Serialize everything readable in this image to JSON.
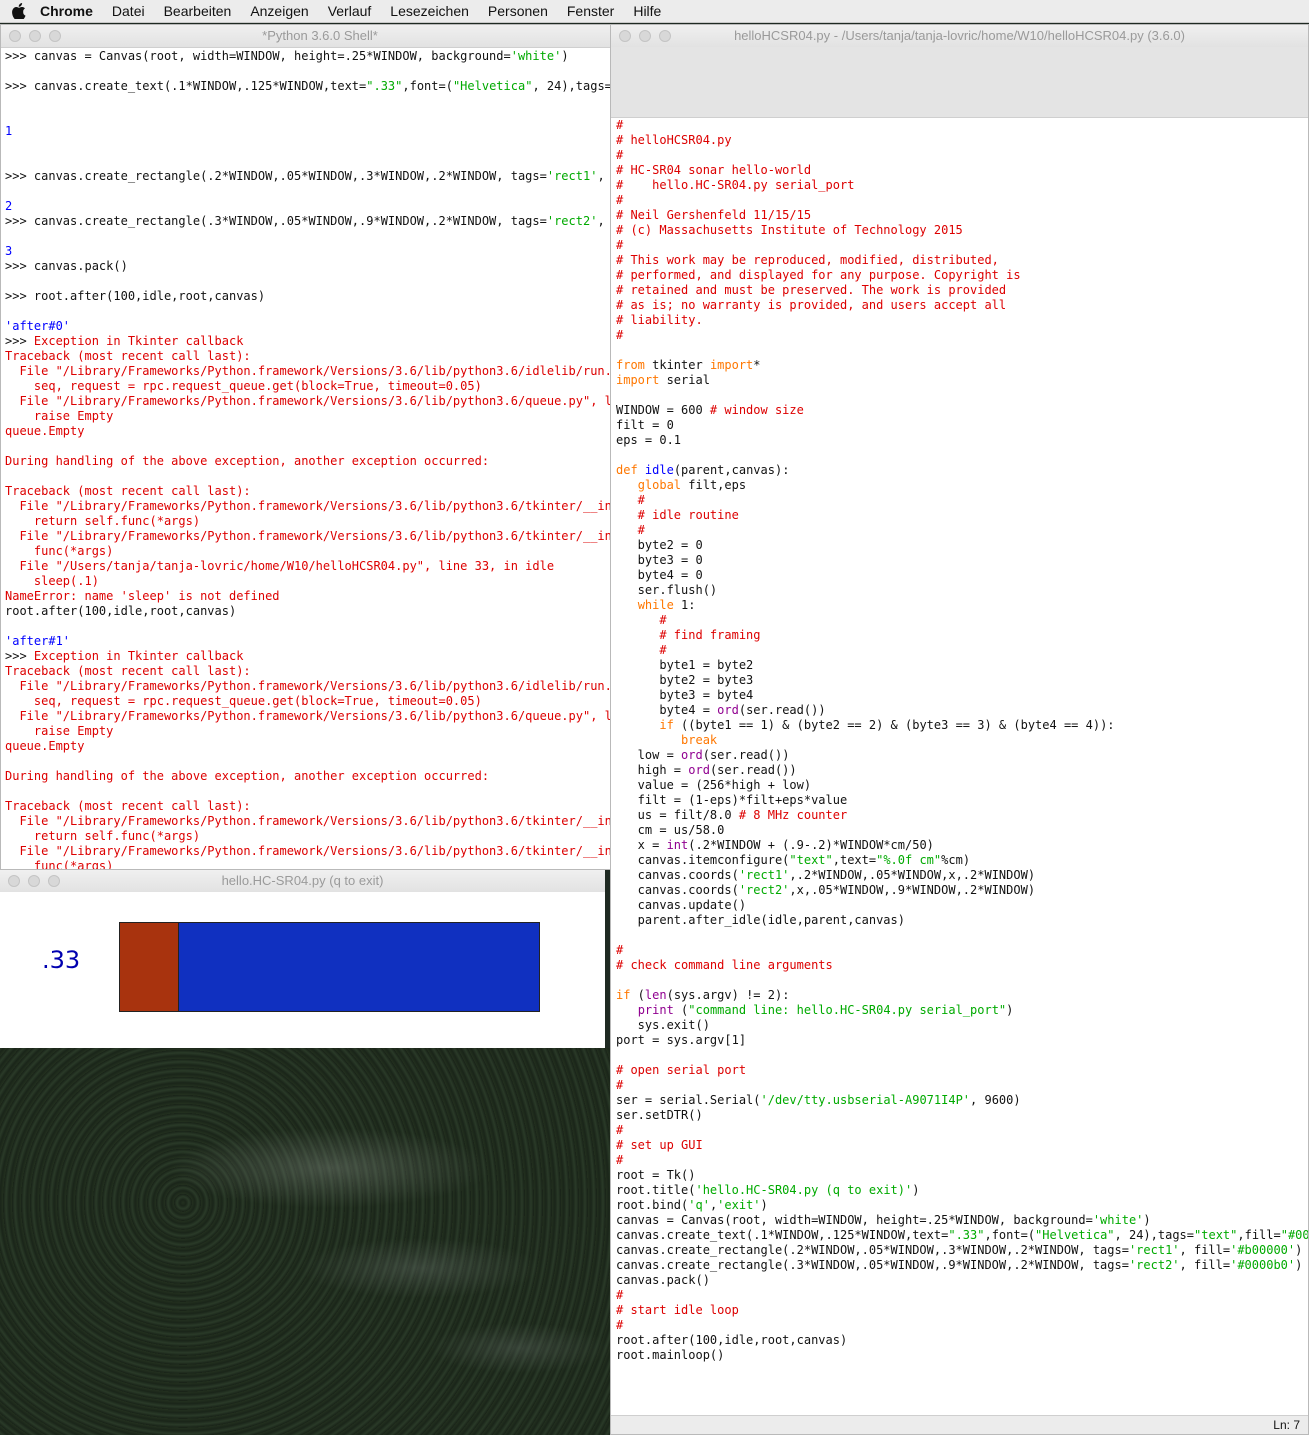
{
  "menubar": {
    "app": "Chrome",
    "items": [
      "Datei",
      "Bearbeiten",
      "Anzeigen",
      "Verlauf",
      "Lesezeichen",
      "Personen",
      "Fenster",
      "Hilfe"
    ]
  },
  "shell": {
    "title": "*Python 3.6.0 Shell*",
    "lines": [
      [
        [
          ">>> ",
          "sh"
        ],
        [
          "canvas = Canvas(root, width=WINDOW, height=.25*WINDOW, background=",
          "sh"
        ],
        [
          "'white'",
          "s"
        ],
        [
          ")",
          "sh"
        ]
      ],
      [
        [
          "",
          "sh"
        ]
      ],
      [
        [
          ">>> ",
          "sh"
        ],
        [
          "canvas.create_text(.1*WINDOW,.125*WINDOW,text=",
          "sh"
        ],
        [
          "\".33\"",
          "s"
        ],
        [
          ",font=(",
          "sh"
        ],
        [
          "\"Helvetica\"",
          "s"
        ],
        [
          ", 24),tags=",
          "sh"
        ],
        [
          "\"te",
          "s"
        ]
      ],
      [
        [
          "",
          "sh"
        ]
      ],
      [
        [
          "",
          "sh"
        ]
      ],
      [
        [
          "1",
          "o"
        ]
      ],
      [
        [
          "",
          "sh"
        ]
      ],
      [
        [
          "",
          "sh"
        ]
      ],
      [
        [
          ">>> ",
          "sh"
        ],
        [
          "canvas.create_rectangle(.2*WINDOW,.05*WINDOW,.3*WINDOW,.2*WINDOW, tags=",
          "sh"
        ],
        [
          "'rect1'",
          "s"
        ],
        [
          ", fil",
          "sh"
        ]
      ],
      [
        [
          "",
          "sh"
        ]
      ],
      [
        [
          "2",
          "o"
        ]
      ],
      [
        [
          ">>> ",
          "sh"
        ],
        [
          "canvas.create_rectangle(.3*WINDOW,.05*WINDOW,.9*WINDOW,.2*WINDOW, tags=",
          "sh"
        ],
        [
          "'rect2'",
          "s"
        ],
        [
          ", fil",
          "sh"
        ]
      ],
      [
        [
          "",
          "sh"
        ]
      ],
      [
        [
          "3",
          "o"
        ]
      ],
      [
        [
          ">>> ",
          "sh"
        ],
        [
          "canvas.pack()",
          "sh"
        ]
      ],
      [
        [
          "",
          "sh"
        ]
      ],
      [
        [
          ">>> ",
          "sh"
        ],
        [
          "root.after(100,idle,root,canvas)",
          "sh"
        ]
      ],
      [
        [
          "",
          "sh"
        ]
      ],
      [
        [
          "'after#0'",
          "o"
        ]
      ],
      [
        [
          ">>> ",
          "sh"
        ],
        [
          "Exception in Tkinter callback",
          "e"
        ]
      ],
      [
        [
          "Traceback (most recent call last):",
          "e"
        ]
      ],
      [
        [
          "  File \"/Library/Frameworks/Python.framework/Versions/3.6/lib/python3.6/idlelib/run.py\"",
          "e"
        ]
      ],
      [
        [
          "    seq, request = rpc.request_queue.get(block=True, timeout=0.05)",
          "e"
        ]
      ],
      [
        [
          "  File \"/Library/Frameworks/Python.framework/Versions/3.6/lib/python3.6/queue.py\", line",
          "e"
        ]
      ],
      [
        [
          "    raise Empty",
          "e"
        ]
      ],
      [
        [
          "queue.Empty",
          "e"
        ]
      ],
      [
        [
          "",
          "sh"
        ]
      ],
      [
        [
          "During handling of the above exception, another exception occurred:",
          "e"
        ]
      ],
      [
        [
          "",
          "sh"
        ]
      ],
      [
        [
          "Traceback (most recent call last):",
          "e"
        ]
      ],
      [
        [
          "  File \"/Library/Frameworks/Python.framework/Versions/3.6/lib/python3.6/tkinter/__init_",
          "e"
        ]
      ],
      [
        [
          "    return self.func(*args)",
          "e"
        ]
      ],
      [
        [
          "  File \"/Library/Frameworks/Python.framework/Versions/3.6/lib/python3.6/tkinter/__init_",
          "e"
        ]
      ],
      [
        [
          "    func(*args)",
          "e"
        ]
      ],
      [
        [
          "  File \"/Users/tanja/tanja-lovric/home/W10/helloHCSR04.py\", line 33, in idle",
          "e"
        ]
      ],
      [
        [
          "    sleep(.1)",
          "e"
        ]
      ],
      [
        [
          "NameError: name 'sleep' is not defined",
          "e"
        ]
      ],
      [
        [
          "root.after(100,idle,root,canvas)",
          "sh"
        ]
      ],
      [
        [
          "",
          "sh"
        ]
      ],
      [
        [
          "'after#1'",
          "o"
        ]
      ],
      [
        [
          ">>> ",
          "sh"
        ],
        [
          "Exception in Tkinter callback",
          "e"
        ]
      ],
      [
        [
          "Traceback (most recent call last):",
          "e"
        ]
      ],
      [
        [
          "  File \"/Library/Frameworks/Python.framework/Versions/3.6/lib/python3.6/idlelib/run.py\"",
          "e"
        ]
      ],
      [
        [
          "    seq, request = rpc.request_queue.get(block=True, timeout=0.05)",
          "e"
        ]
      ],
      [
        [
          "  File \"/Library/Frameworks/Python.framework/Versions/3.6/lib/python3.6/queue.py\", line",
          "e"
        ]
      ],
      [
        [
          "    raise Empty",
          "e"
        ]
      ],
      [
        [
          "queue.Empty",
          "e"
        ]
      ],
      [
        [
          "",
          "sh"
        ]
      ],
      [
        [
          "During handling of the above exception, another exception occurred:",
          "e"
        ]
      ],
      [
        [
          "",
          "sh"
        ]
      ],
      [
        [
          "Traceback (most recent call last):",
          "e"
        ]
      ],
      [
        [
          "  File \"/Library/Frameworks/Python.framework/Versions/3.6/lib/python3.6/tkinter/__init_",
          "e"
        ]
      ],
      [
        [
          "    return self.func(*args)",
          "e"
        ]
      ],
      [
        [
          "  File \"/Library/Frameworks/Python.framework/Versions/3.6/lib/python3.6/tkinter/__init_",
          "e"
        ]
      ],
      [
        [
          "    func(*args)",
          "e"
        ]
      ]
    ]
  },
  "hello": {
    "title": "hello.HC-SR04.py (q to exit)",
    "text": ".33",
    "text_color": "#0000b0",
    "rect1_color": "#a8330e",
    "rect2_color": "#1030c0",
    "fraction_rect1": 0.33
  },
  "editor": {
    "title": "helloHCSR04.py - /Users/tanja/tanja-lovric/home/W10/helloHCSR04.py (3.6.0)",
    "status": "Ln: 7",
    "lines": [
      [
        [
          "#",
          "c"
        ]
      ],
      [
        [
          "# helloHCSR04.py",
          "c"
        ]
      ],
      [
        [
          "#",
          "c"
        ]
      ],
      [
        [
          "# HC-SR04 sonar hello-world",
          "c"
        ]
      ],
      [
        [
          "#    hello.HC-SR04.py serial_port",
          "c"
        ]
      ],
      [
        [
          "#",
          "c"
        ]
      ],
      [
        [
          "# Neil Gershenfeld 11/15/15",
          "c"
        ]
      ],
      [
        [
          "# (c) Massachusetts Institute of Technology 2015",
          "c"
        ]
      ],
      [
        [
          "#",
          "c"
        ]
      ],
      [
        [
          "# This work may be reproduced, modified, distributed,",
          "c"
        ]
      ],
      [
        [
          "# performed, and displayed for any purpose. Copyright is",
          "c"
        ]
      ],
      [
        [
          "# retained and must be preserved. The work is provided",
          "c"
        ]
      ],
      [
        [
          "# as is; no warranty is provided, and users accept all",
          "c"
        ]
      ],
      [
        [
          "# liability.",
          "c"
        ]
      ],
      [
        [
          "#",
          "c"
        ]
      ],
      [
        [
          "",
          "sh"
        ]
      ],
      [
        [
          "from",
          "k"
        ],
        [
          " tkinter ",
          "sh"
        ],
        [
          "import",
          "k"
        ],
        [
          "*",
          "sh"
        ]
      ],
      [
        [
          "import",
          "k"
        ],
        [
          " serial",
          "sh"
        ]
      ],
      [
        [
          "",
          "sh"
        ]
      ],
      [
        [
          "WINDOW = 600 ",
          "sh"
        ],
        [
          "# window size",
          "c"
        ]
      ],
      [
        [
          "filt = 0",
          "sh"
        ]
      ],
      [
        [
          "eps = 0.1",
          "sh"
        ]
      ],
      [
        [
          "",
          "sh"
        ]
      ],
      [
        [
          "def",
          "k"
        ],
        [
          " ",
          "sh"
        ],
        [
          "idle",
          "d"
        ],
        [
          "(parent,canvas):",
          "sh"
        ]
      ],
      [
        [
          "   ",
          "sh"
        ],
        [
          "global",
          "k"
        ],
        [
          " filt,eps",
          "sh"
        ]
      ],
      [
        [
          "   #",
          "c"
        ]
      ],
      [
        [
          "   # idle routine",
          "c"
        ]
      ],
      [
        [
          "   #",
          "c"
        ]
      ],
      [
        [
          "   byte2 = 0",
          "sh"
        ]
      ],
      [
        [
          "   byte3 = 0",
          "sh"
        ]
      ],
      [
        [
          "   byte4 = 0",
          "sh"
        ]
      ],
      [
        [
          "   ser.flush()",
          "sh"
        ]
      ],
      [
        [
          "   ",
          "sh"
        ],
        [
          "while",
          "k"
        ],
        [
          " 1:",
          "sh"
        ]
      ],
      [
        [
          "      #",
          "c"
        ]
      ],
      [
        [
          "      # find framing",
          "c"
        ]
      ],
      [
        [
          "      #",
          "c"
        ]
      ],
      [
        [
          "      byte1 = byte2",
          "sh"
        ]
      ],
      [
        [
          "      byte2 = byte3",
          "sh"
        ]
      ],
      [
        [
          "      byte3 = byte4",
          "sh"
        ]
      ],
      [
        [
          "      byte4 = ",
          "sh"
        ],
        [
          "ord",
          "b"
        ],
        [
          "(ser.read())",
          "sh"
        ]
      ],
      [
        [
          "      ",
          "sh"
        ],
        [
          "if",
          "k"
        ],
        [
          " ((byte1 == 1) & (byte2 == 2) & (byte3 == 3) & (byte4 == 4)):",
          "sh"
        ]
      ],
      [
        [
          "         ",
          "sh"
        ],
        [
          "break",
          "k"
        ]
      ],
      [
        [
          "   low = ",
          "sh"
        ],
        [
          "ord",
          "b"
        ],
        [
          "(ser.read())",
          "sh"
        ]
      ],
      [
        [
          "   high = ",
          "sh"
        ],
        [
          "ord",
          "b"
        ],
        [
          "(ser.read())",
          "sh"
        ]
      ],
      [
        [
          "   value = (256*high + low)",
          "sh"
        ]
      ],
      [
        [
          "   filt = (1-eps)*filt+eps*value",
          "sh"
        ]
      ],
      [
        [
          "   us = filt/8.0 ",
          "sh"
        ],
        [
          "# 8 MHz counter",
          "c"
        ]
      ],
      [
        [
          "   cm = us/58.0",
          "sh"
        ]
      ],
      [
        [
          "   x = ",
          "sh"
        ],
        [
          "int",
          "b"
        ],
        [
          "(.2*WINDOW + (.9-.2)*WINDOW*cm/50)",
          "sh"
        ]
      ],
      [
        [
          "   canvas.itemconfigure(",
          "sh"
        ],
        [
          "\"text\"",
          "s"
        ],
        [
          ",text=",
          "sh"
        ],
        [
          "\"%.0f cm\"",
          "s"
        ],
        [
          "%cm)",
          "sh"
        ]
      ],
      [
        [
          "   canvas.coords(",
          "sh"
        ],
        [
          "'rect1'",
          "s"
        ],
        [
          ",.2*WINDOW,.05*WINDOW,x,.2*WINDOW)",
          "sh"
        ]
      ],
      [
        [
          "   canvas.coords(",
          "sh"
        ],
        [
          "'rect2'",
          "s"
        ],
        [
          ",x,.05*WINDOW,.9*WINDOW,.2*WINDOW)",
          "sh"
        ]
      ],
      [
        [
          "   canvas.update()",
          "sh"
        ]
      ],
      [
        [
          "   parent.after_idle(idle,parent,canvas)",
          "sh"
        ]
      ],
      [
        [
          "",
          "sh"
        ]
      ],
      [
        [
          "#",
          "c"
        ]
      ],
      [
        [
          "# check command line arguments",
          "c"
        ]
      ],
      [
        [
          "",
          "sh"
        ]
      ],
      [
        [
          "if",
          "k"
        ],
        [
          " (",
          "sh"
        ],
        [
          "len",
          "b"
        ],
        [
          "(sys.argv) != 2):",
          "sh"
        ]
      ],
      [
        [
          "   ",
          "sh"
        ],
        [
          "print",
          "b"
        ],
        [
          " (",
          "sh"
        ],
        [
          "\"command line: hello.HC-SR04.py serial_port\"",
          "s"
        ],
        [
          ")",
          "sh"
        ]
      ],
      [
        [
          "   sys.exit()",
          "sh"
        ]
      ],
      [
        [
          "port = sys.argv[1]",
          "sh"
        ]
      ],
      [
        [
          "",
          "sh"
        ]
      ],
      [
        [
          "# open serial port",
          "c"
        ]
      ],
      [
        [
          "#",
          "c"
        ]
      ],
      [
        [
          "ser = serial.Serial(",
          "sh"
        ],
        [
          "'/dev/tty.usbserial-A9071I4P'",
          "s"
        ],
        [
          ", 9600)",
          "sh"
        ]
      ],
      [
        [
          "ser.setDTR()",
          "sh"
        ]
      ],
      [
        [
          "#",
          "c"
        ]
      ],
      [
        [
          "# set up GUI",
          "c"
        ]
      ],
      [
        [
          "#",
          "c"
        ]
      ],
      [
        [
          "root = Tk()",
          "sh"
        ]
      ],
      [
        [
          "root.title(",
          "sh"
        ],
        [
          "'hello.HC-SR04.py (q to exit)'",
          "s"
        ],
        [
          ")",
          "sh"
        ]
      ],
      [
        [
          "root.bind(",
          "sh"
        ],
        [
          "'q'",
          "s"
        ],
        [
          ",",
          "sh"
        ],
        [
          "'exit'",
          "s"
        ],
        [
          ")",
          "sh"
        ]
      ],
      [
        [
          "canvas = Canvas(root, width=WINDOW, height=.25*WINDOW, background=",
          "sh"
        ],
        [
          "'white'",
          "s"
        ],
        [
          ")",
          "sh"
        ]
      ],
      [
        [
          "canvas.create_text(.1*WINDOW,.125*WINDOW,text=",
          "sh"
        ],
        [
          "\".33\"",
          "s"
        ],
        [
          ",font=(",
          "sh"
        ],
        [
          "\"Helvetica\"",
          "s"
        ],
        [
          ", 24),tags=",
          "sh"
        ],
        [
          "\"text\"",
          "s"
        ],
        [
          ",fill=",
          "sh"
        ],
        [
          "\"#0000b0",
          "s"
        ]
      ],
      [
        [
          "canvas.create_rectangle(.2*WINDOW,.05*WINDOW,.3*WINDOW,.2*WINDOW, tags=",
          "sh"
        ],
        [
          "'rect1'",
          "s"
        ],
        [
          ", fill=",
          "sh"
        ],
        [
          "'#b00000'",
          "s"
        ],
        [
          ")",
          "sh"
        ]
      ],
      [
        [
          "canvas.create_rectangle(.3*WINDOW,.05*WINDOW,.9*WINDOW,.2*WINDOW, tags=",
          "sh"
        ],
        [
          "'rect2'",
          "s"
        ],
        [
          ", fill=",
          "sh"
        ],
        [
          "'#0000b0'",
          "s"
        ],
        [
          ")",
          "sh"
        ]
      ],
      [
        [
          "canvas.pack()",
          "sh"
        ]
      ],
      [
        [
          "#",
          "c"
        ]
      ],
      [
        [
          "# start idle loop",
          "c"
        ]
      ],
      [
        [
          "#",
          "c"
        ]
      ],
      [
        [
          "root.after(100,idle,root,canvas)",
          "sh"
        ]
      ],
      [
        [
          "root.mainloop()",
          "sh"
        ]
      ]
    ]
  }
}
